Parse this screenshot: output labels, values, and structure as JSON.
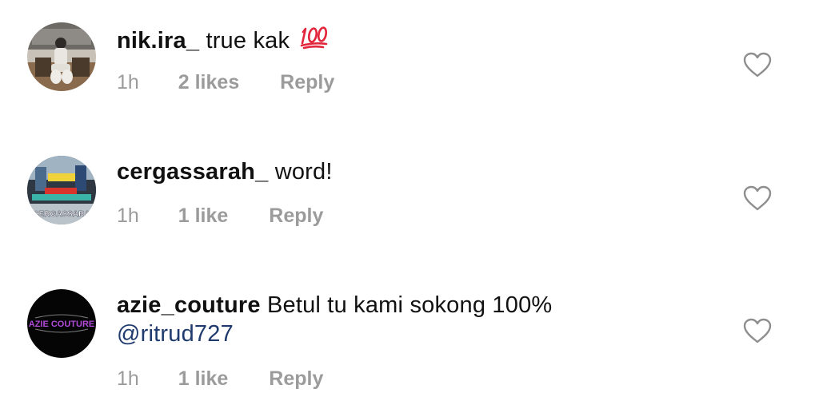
{
  "comments": [
    {
      "username": "nik.ira_",
      "text": "true kak",
      "emoji": "100-emoji-icon",
      "time": "1h",
      "likes": "2 likes",
      "reply": "Reply",
      "like_icon": "heart-outline-icon"
    },
    {
      "username": "cergassarah_",
      "text": "word!",
      "avatar_text": "CERGASSARA",
      "time": "1h",
      "likes": "1 like",
      "reply": "Reply",
      "like_icon": "heart-outline-icon"
    },
    {
      "username": "azie_couture",
      "text": "Betul tu kami sokong 100%",
      "mention": "@ritrud727",
      "avatar_text": "AZIE COUTURE",
      "time": "1h",
      "likes": "1 like",
      "reply": "Reply",
      "like_icon": "heart-outline-icon"
    }
  ],
  "colors": {
    "text": "#111111",
    "meta": "#9b9b9b",
    "mention": "#1f3b6e",
    "emoji_red": "#e2263b",
    "azie_logo": "#b04ad8"
  }
}
